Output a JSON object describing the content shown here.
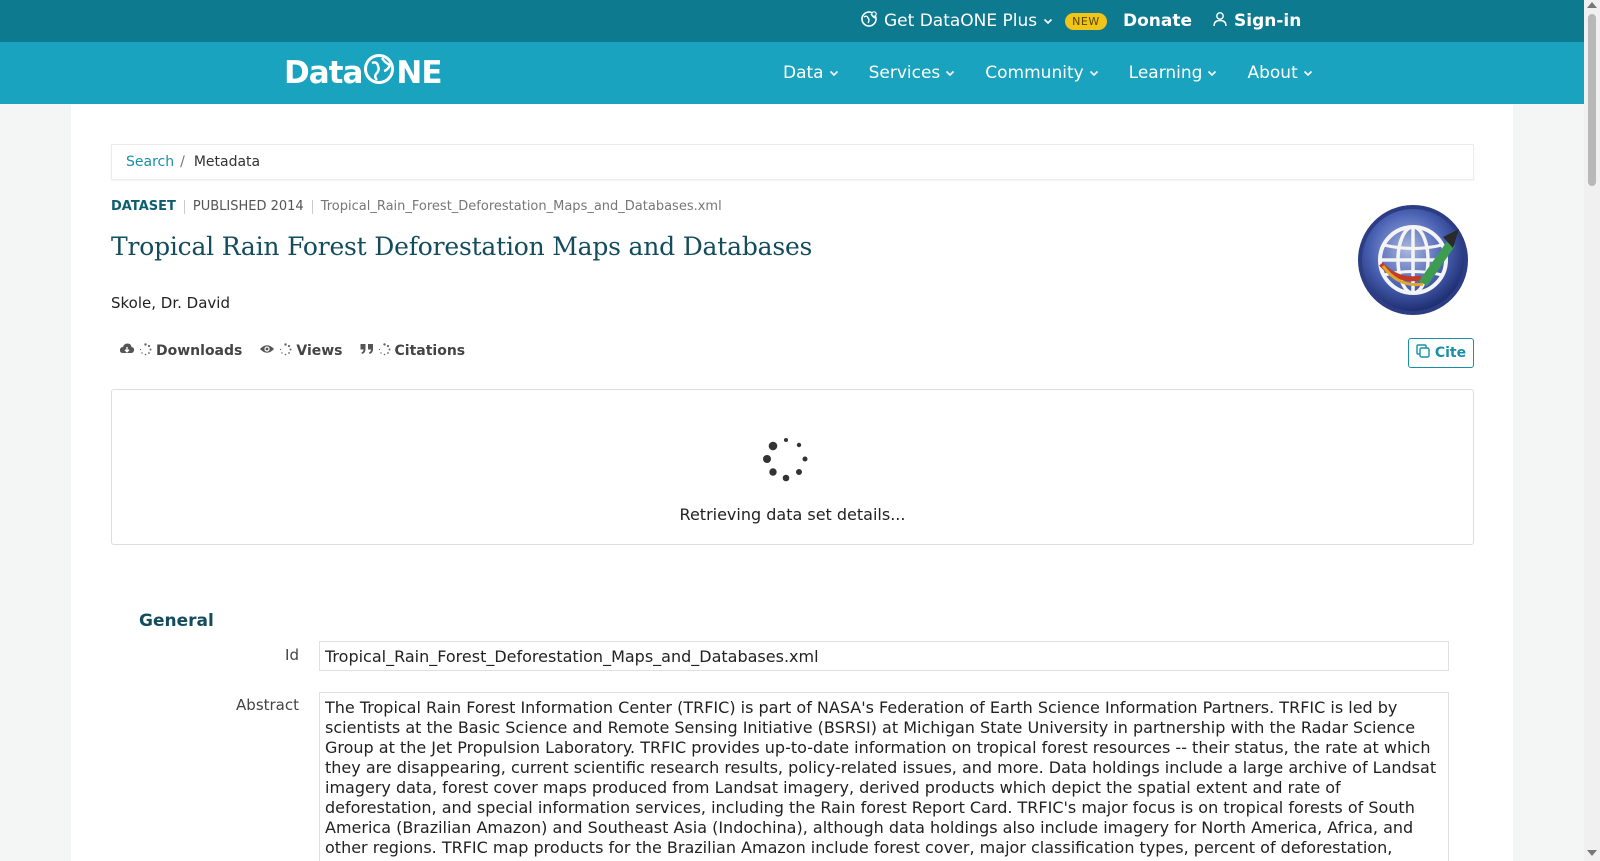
{
  "topbar": {
    "plus_label": "Get DataONE Plus",
    "plus_badge": "NEW",
    "donate_label": "Donate",
    "signin_label": "Sign-in"
  },
  "nav": {
    "logo_text_left": "Data",
    "logo_text_right": "NE",
    "items": [
      {
        "label": "Data"
      },
      {
        "label": "Services"
      },
      {
        "label": "Community"
      },
      {
        "label": "Learning"
      },
      {
        "label": "About"
      }
    ]
  },
  "breadcrumb": {
    "search_label": "Search",
    "separator": "/",
    "current": "Metadata"
  },
  "dataset": {
    "type_label": "DATASET",
    "published": "PUBLISHED 2014",
    "file": "Tropical_Rain_Forest_Deforestation_Maps_and_Databases.xml",
    "title": "Tropical Rain Forest Deforestation Maps and Databases",
    "author": "Skole, Dr. David"
  },
  "stats": {
    "downloads_label": "Downloads",
    "views_label": "Views",
    "citations_label": "Citations"
  },
  "cite_label": "Cite",
  "loading_text": "Retrieving data set details...",
  "general": {
    "section_title": "General",
    "id_label": "Id",
    "id_value": "Tropical_Rain_Forest_Deforestation_Maps_and_Databases.xml",
    "abstract_label": "Abstract",
    "abstract_value": "The Tropical Rain Forest Information Center (TRFIC) is part of NASA's Federation of Earth Science Information Partners. TRFIC is led by scientists at the Basic Science and Remote Sensing Initiative (BSRSI) at Michigan State University in partnership with the Radar Science Group at the Jet Propulsion Laboratory. TRFIC provides up-to-date information on tropical forest resources -- their status, the rate at which they are disappearing, current scientific research results, policy-related issues, and more. Data holdings include a large archive of Landsat imagery data, forest cover maps produced from Landsat imagery, derived products which depict the spatial extent and rate of deforestation, and special information services, including the Rain forest Report Card. TRFIC's major focus is on tropical forests of South America (Brazilian Amazon) and Southeast Asia (Indochina), although data holdings also include imagery for North America, Africa, and other regions. TRFIC map products for the Brazilian Amazon include forest cover, major classification types, percent of deforestation, vegetation and transition"
  },
  "colors": {
    "topbar": "#0d7a8f",
    "nav": "#1aa3bf",
    "accent": "#1a8fa8",
    "title": "#134c5c",
    "badge": "#f0c419"
  }
}
